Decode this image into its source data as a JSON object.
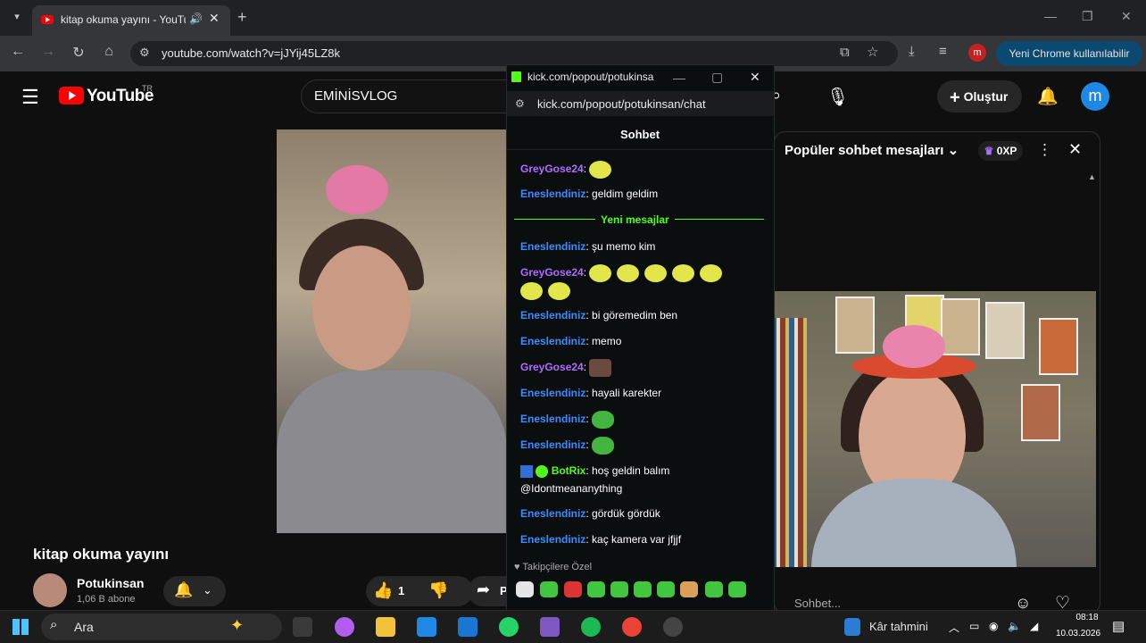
{
  "browser": {
    "tab_title": "kitap okuma yayını - YouTube",
    "url": "youtube.com/watch?v=jJYij45LZ8k",
    "profile_initial": "m",
    "update_button": "Yeni Chrome kullanılabilir"
  },
  "youtube": {
    "logo_text": "YouTube",
    "region": "TR",
    "search_value": "EMİNİSVLOG",
    "create_label": "Oluştur",
    "avatar_initial": "m",
    "video_title": "kitap okuma yayını",
    "channel_name": "Potukinsan",
    "channel_subs": "1,06 B abone",
    "like_count": "1",
    "share_label": "P",
    "chat_title": "Popüler sohbet mesajları",
    "chat_xp": "0XP",
    "chat_placeholder": "Sohbet..."
  },
  "kick": {
    "window_title": "kick.com/popout/potukinsa...",
    "url": "kick.com/popout/potukinsan/chat",
    "header": "Sohbet",
    "new_messages": "Yeni mesajlar",
    "followers_only": "Takipçilere Özel",
    "messages": [
      {
        "user": "GreyGose24",
        "text": ""
      },
      {
        "user": "Eneslendiniz",
        "text": "geldim geldim"
      },
      {
        "user": "Eneslendiniz",
        "text": "şu memo kim"
      },
      {
        "user": "GreyGose24",
        "text": ""
      },
      {
        "user": "Eneslendiniz",
        "text": "bi göremedim ben"
      },
      {
        "user": "Eneslendiniz",
        "text": "memo"
      },
      {
        "user": "GreyGose24",
        "text": ""
      },
      {
        "user": "Eneslendiniz",
        "text": "hayali karekter"
      },
      {
        "user": "Eneslendiniz",
        "text": ""
      },
      {
        "user": "Eneslendiniz",
        "text": ""
      },
      {
        "user": "BotRix",
        "text": "hoş geldin balım"
      },
      {
        "user": "",
        "text": "@Idontmeananything"
      },
      {
        "user": "Eneslendiniz",
        "text": "gördük gördük"
      },
      {
        "user": "Eneslendiniz",
        "text": "kaç kamera var jfjjf"
      }
    ]
  },
  "taskbar": {
    "search_label": "Ara",
    "weather": "Kâr tahmini",
    "time": "08:18",
    "date": "10.03.2026"
  }
}
